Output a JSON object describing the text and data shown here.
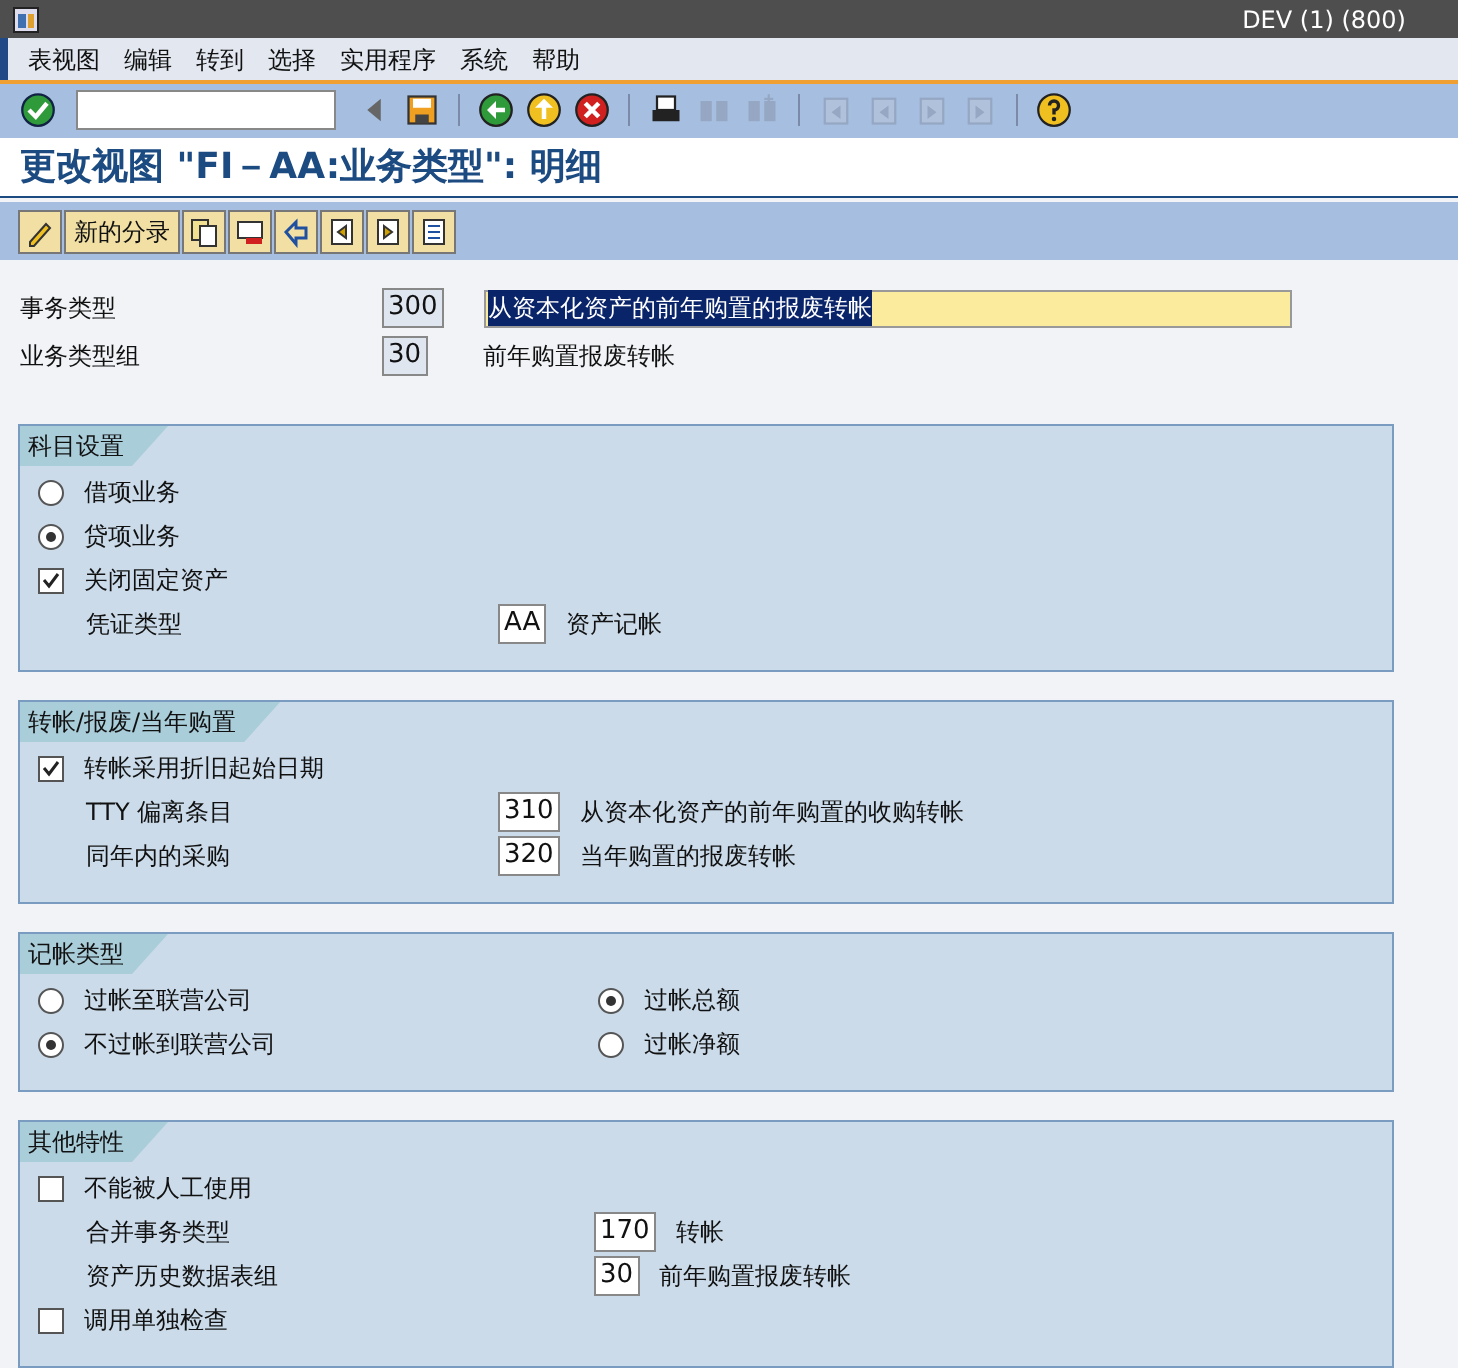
{
  "window": {
    "system": "DEV (1) (800)"
  },
  "menu": [
    "表视图",
    "编辑",
    "转到",
    "选择",
    "实用程序",
    "系统",
    "帮助"
  ],
  "toolbar": [
    {
      "kind": "enter",
      "disabled": false
    },
    {
      "kind": "command"
    },
    {
      "kind": "history",
      "disabled": false
    },
    {
      "kind": "save",
      "disabled": false
    },
    {
      "kind": "sep"
    },
    {
      "kind": "back",
      "disabled": false
    },
    {
      "kind": "exit",
      "disabled": false
    },
    {
      "kind": "cancel",
      "disabled": false
    },
    {
      "kind": "sep"
    },
    {
      "kind": "print",
      "disabled": false
    },
    {
      "kind": "find",
      "disabled": true
    },
    {
      "kind": "find_next",
      "disabled": true
    },
    {
      "kind": "sep"
    },
    {
      "kind": "first_page",
      "disabled": true
    },
    {
      "kind": "prev_page",
      "disabled": true
    },
    {
      "kind": "next_page",
      "disabled": true
    },
    {
      "kind": "last_page",
      "disabled": true
    },
    {
      "kind": "sep"
    },
    {
      "kind": "help",
      "disabled": false
    }
  ],
  "title": "更改视图 \"FI－AA:业务类型\": 明细",
  "app_toolbar": [
    {
      "kind": "toggle"
    },
    {
      "kind": "text",
      "label": "新的分录"
    },
    {
      "kind": "copy"
    },
    {
      "kind": "delete"
    },
    {
      "kind": "undo"
    },
    {
      "kind": "previous"
    },
    {
      "kind": "next"
    },
    {
      "kind": "other"
    }
  ],
  "header_fields": [
    {
      "label": "事务类型",
      "value": "300",
      "description": "从资本化资产的前年购置的报废转帐",
      "highlighted": true
    },
    {
      "label": "业务类型组",
      "value": "30",
      "description": "前年购置报废转帐",
      "highlighted": false
    }
  ],
  "groups": [
    {
      "title": "科目设置",
      "columns": [
        [
          {
            "kind": "radio",
            "label": "借项业务",
            "selected": false
          },
          {
            "kind": "radio",
            "label": "贷项业务",
            "selected": true
          },
          {
            "kind": "checkbox",
            "label": "关闭固定资产",
            "checked": true
          },
          {
            "kind": "field",
            "label": "凭证类型",
            "value": "AA",
            "description": "资产记帐"
          }
        ]
      ]
    },
    {
      "title": "转帐/报废/当年购置",
      "columns": [
        [
          {
            "kind": "checkbox",
            "label": "转帐采用折旧起始日期",
            "checked": true
          },
          {
            "kind": "field",
            "label": "TTY 偏离条目",
            "value": "310",
            "description": "从资本化资产的前年购置的收购转帐"
          },
          {
            "kind": "field",
            "label": "同年内的采购",
            "value": "320",
            "description": "当年购置的报废转帐"
          }
        ]
      ]
    },
    {
      "title": "记帐类型",
      "columns": [
        [
          {
            "kind": "radio",
            "label": "过帐至联营公司",
            "selected": false
          },
          {
            "kind": "radio",
            "label": "不过帐到联营公司",
            "selected": true
          }
        ],
        [
          {
            "kind": "radio",
            "label": "过帐总额",
            "selected": true
          },
          {
            "kind": "radio",
            "label": "过帐净额",
            "selected": false
          }
        ]
      ]
    },
    {
      "title": "其他特性",
      "columns": [
        [
          {
            "kind": "checkbox",
            "label": "不能被人工使用",
            "checked": false
          },
          {
            "kind": "field",
            "label": "合并事务类型",
            "value": "170",
            "description": "转帐"
          },
          {
            "kind": "field",
            "label": "资产历史数据表组",
            "value": "30",
            "description": "前年购置报废转帐"
          },
          {
            "kind": "checkbox",
            "label": "调用单独检查",
            "checked": false
          }
        ]
      ]
    }
  ]
}
